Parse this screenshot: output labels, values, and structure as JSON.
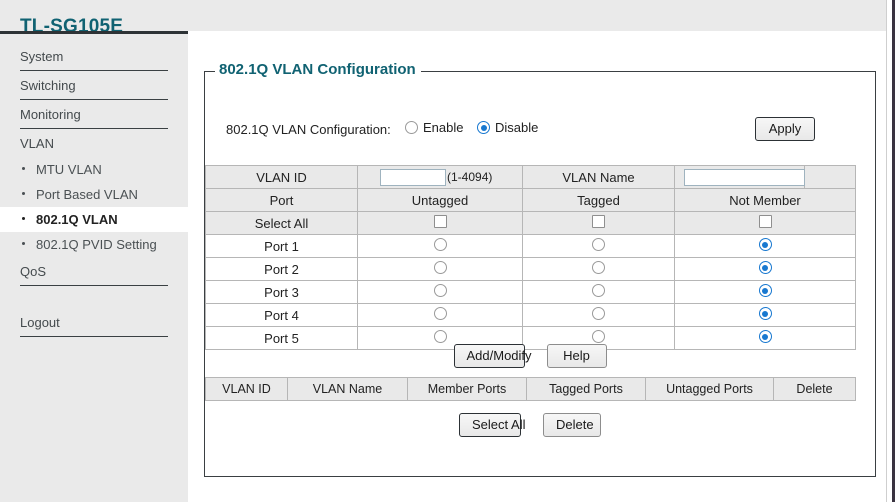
{
  "brand": "TL-SG105E",
  "sidebar": {
    "top_items": [
      {
        "label": "System"
      },
      {
        "label": "Switching"
      },
      {
        "label": "Monitoring"
      },
      {
        "label": "VLAN"
      }
    ],
    "vlan_sub_items": [
      {
        "label": "MTU VLAN",
        "active": false
      },
      {
        "label": "Port Based VLAN",
        "active": false
      },
      {
        "label": "802.1Q VLAN",
        "active": true
      },
      {
        "label": "802.1Q PVID Setting",
        "active": false
      }
    ],
    "qos_label": "QoS",
    "logout_label": "Logout"
  },
  "panel": {
    "legend": "802.1Q VLAN Configuration",
    "enable_row": {
      "label": "802.1Q VLAN Configuration:",
      "options": [
        {
          "label": "Enable",
          "selected": false
        },
        {
          "label": "Disable",
          "selected": true
        }
      ],
      "apply_label": "Apply"
    },
    "vlan_table": {
      "id_label": "VLAN ID",
      "id_value": "",
      "id_placeholder": "",
      "id_hint": "(1-4094)",
      "name_label": "VLAN Name",
      "name_value": "",
      "name_placeholder": "",
      "port_header": "Port",
      "untagged_header": "Untagged",
      "tagged_header": "Tagged",
      "not_member_header": "Not Member",
      "select_all_label": "Select All",
      "rows": [
        {
          "port": "Port 1",
          "untagged": false,
          "tagged": false,
          "not_member": true
        },
        {
          "port": "Port 2",
          "untagged": false,
          "tagged": false,
          "not_member": true
        },
        {
          "port": "Port 3",
          "untagged": false,
          "tagged": false,
          "not_member": true
        },
        {
          "port": "Port 4",
          "untagged": false,
          "tagged": false,
          "not_member": true
        },
        {
          "port": "Port 5",
          "untagged": false,
          "tagged": false,
          "not_member": true
        }
      ]
    },
    "mid_buttons": {
      "add_modify_label": "Add/Modify",
      "help_label": "Help"
    },
    "result_table": {
      "headers": [
        "VLAN ID",
        "VLAN Name",
        "Member Ports",
        "Tagged Ports",
        "Untagged Ports",
        "Delete"
      ],
      "rows": []
    },
    "bottom_buttons": {
      "select_all_label": "Select All",
      "delete_label": "Delete"
    }
  },
  "colors": {
    "brand_teal": "#106272",
    "sidebar_bg": "#eaeaea",
    "radio_blue": "#1878d0",
    "panel_border": "#3a3f42"
  }
}
